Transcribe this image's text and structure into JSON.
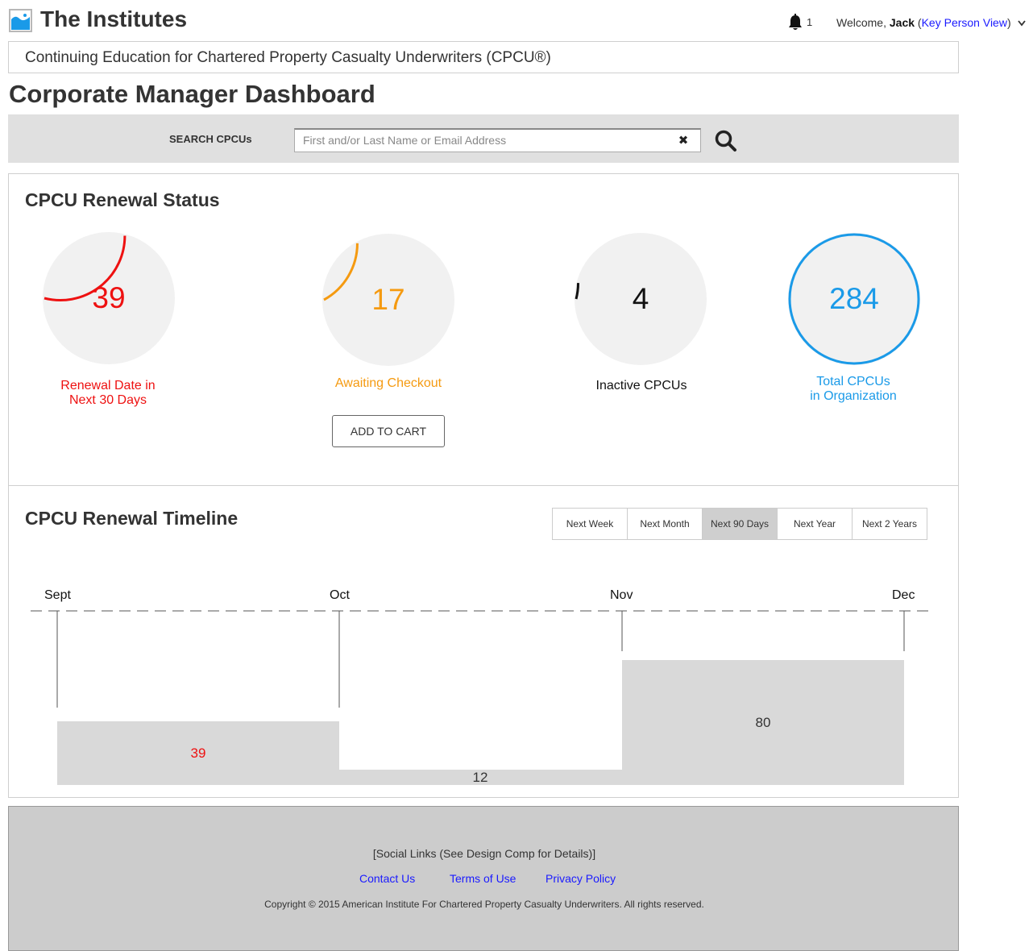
{
  "header": {
    "site_title": "The Institutes",
    "notification_count": "1",
    "welcome_prefix": "Welcome, ",
    "user_name": "Jack",
    "view_link": "Key Person View"
  },
  "program_title": "Continuing Education for Chartered Property Casualty Underwriters (CPCU®)",
  "page_title": "Corporate Manager Dashboard",
  "search": {
    "label": "SEARCH CPCUs",
    "placeholder": "First and/or Last Name or Email Address",
    "clear_glyph": "✖"
  },
  "renewal_status": {
    "title": "CPCU Renewal Status",
    "cards": [
      {
        "value": "39",
        "label_line1": "Renewal Date in",
        "label_line2": "Next 30 Days",
        "color": "#ee1111",
        "progress": 0.29
      },
      {
        "value": "17",
        "label_line1": "Awaiting Checkout",
        "label_line2": "",
        "color": "#f59a10",
        "progress": 0.17
      },
      {
        "value": "4",
        "label_line1": "Inactive CPCUs",
        "label_line2": "",
        "color": "#111111",
        "progress": 0.04
      },
      {
        "value": "284",
        "label_line1": "Total CPCUs",
        "label_line2": "in Organization",
        "color": "#1a9ae8",
        "progress": 1.0
      }
    ],
    "add_to_cart": "ADD TO CART"
  },
  "timeline": {
    "title": "CPCU Renewal Timeline",
    "tabs": [
      "Next Week",
      "Next Month",
      "Next 90 Days",
      "Next Year",
      "Next 2 Years"
    ],
    "active_tab": "Next 90 Days",
    "months": [
      "Sept",
      "Oct",
      "Nov",
      "Dec"
    ],
    "bars": [
      {
        "value": "39",
        "color": "#ee1111"
      },
      {
        "value": "12",
        "color": "#333333"
      },
      {
        "value": "80",
        "color": "#333333"
      }
    ]
  },
  "footer": {
    "social": "[Social Links (See Design Comp for Details)]",
    "links": [
      "Contact Us",
      "Terms of Use",
      "Privacy Policy"
    ],
    "copyright": "Copyright © 2015 American Institute For Chartered Property Casualty Underwriters. All rights reserved."
  },
  "colors": {
    "link_blue": "#1a1aff",
    "panel_gray": "#e0e0e0",
    "footer_gray": "#cccccc"
  }
}
